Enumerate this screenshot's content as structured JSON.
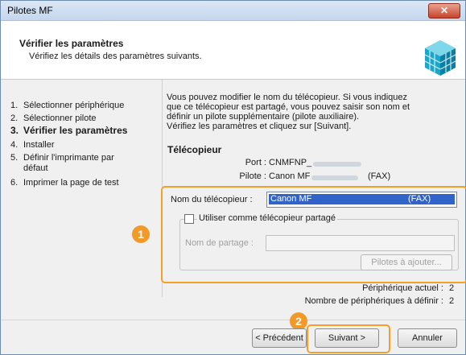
{
  "window": {
    "title": "Pilotes MF",
    "close_label": "✕"
  },
  "header": {
    "title": "Vérifier les paramètres",
    "subtitle": "Vérifiez les détails des paramètres suivants.",
    "icon": "installer-cube-icon"
  },
  "steps": [
    {
      "num": "1.",
      "label": "Sélectionner périphérique"
    },
    {
      "num": "2.",
      "label": "Sélectionner pilote"
    },
    {
      "num": "3.",
      "label": "Vérifier les paramètres"
    },
    {
      "num": "4.",
      "label": "Installer"
    },
    {
      "num": "5.",
      "label": "Définir l'imprimante par défaut"
    },
    {
      "num": "6.",
      "label": "Imprimer la page de test"
    }
  ],
  "intro": {
    "line1": "Vous pouvez modifier le nom du télécopieur. Si vous indiquez",
    "line2": "que ce télécopieur est partagé, vous pouvez saisir son nom et",
    "line3": "définir un pilote supplémentaire (pilote auxiliaire).",
    "line4": "Vérifiez les paramètres et cliquez sur [Suivant]."
  },
  "fax": {
    "section_title": "Télécopieur",
    "port_label": "Port :",
    "port_value": "CNMFNP_",
    "driver_label": "Pilote :",
    "driver_value": "Canon MF",
    "driver_suffix": "(FAX)"
  },
  "form": {
    "name_label": "Nom du télécopieur :",
    "name_value": "Canon MF",
    "name_suffix": "(FAX)",
    "share_checkbox_label": "Utiliser comme télécopieur partagé",
    "share_checked": false,
    "share_name_label": "Nom de partage :",
    "share_name_value": "",
    "add_drivers_label": "Pilotes à ajouter..."
  },
  "stats": {
    "current_label": "Périphérique actuel :",
    "current_value": "2",
    "total_label": "Nombre de périphériques à définir :",
    "total_value": "2"
  },
  "buttons": {
    "back": "< Précédent",
    "next": "Suivant >",
    "cancel": "Annuler"
  },
  "callouts": {
    "one": "1",
    "two": "2"
  },
  "colors": {
    "accent_orange": "#f39f2c",
    "selection_blue": "#3064c8"
  }
}
